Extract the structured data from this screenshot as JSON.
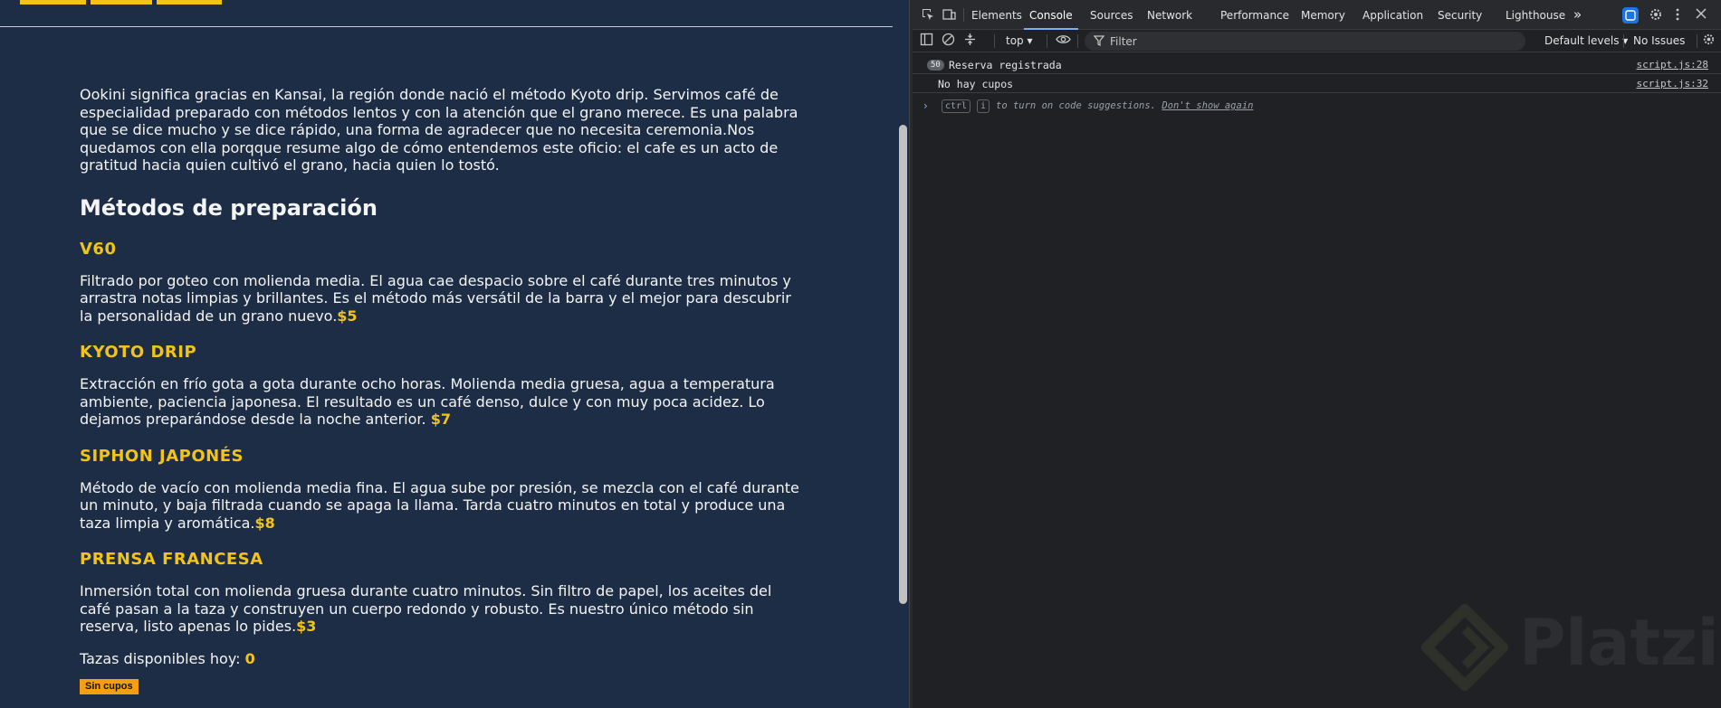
{
  "page": {
    "intro": "Ookini significa gracias en Kansai, la región donde nació el método Kyoto drip. Servimos café de especialidad preparado con métodos lentos y con la atención que el grano merece. Es una palabra que se dice mucho y se dice rápido, una forma de agradecer que no necesita ceremonia.Nos quedamos con ella porqque resume algo de cómo entendemos este oficio: el cafe es un acto de gratitud hacia quien cultivó el grano, hacia quien lo tostó.",
    "methods_heading": "Métodos de preparación",
    "methods": [
      {
        "title": "V60",
        "description": "Filtrado por goteo con molienda media. El agua cae despacio sobre el café durante tres minutos y arrastra notas limpias y brillantes. Es el método más versátil de la barra y el mejor para descubrir la personalidad de un grano nuevo.",
        "price": "$5"
      },
      {
        "title": "KYOTO DRIP",
        "description": "Extracción en frío gota a gota durante ocho horas. Molienda media gruesa, agua a temperatura ambiente, paciencia japonesa. El resultado es un café denso, dulce y con muy poca acidez. Lo dejamos preparándose desde la noche anterior. ",
        "price": "$7"
      },
      {
        "title": "SIPHON JAPONÉS",
        "description": "Método de vacío con molienda media fina. El agua sube por presión, se mezcla con el café durante un minuto, y baja filtrada cuando se apaga la llama. Tarda cuatro minutos en total y produce una taza limpia y aromática.",
        "price": "$8"
      },
      {
        "title": "PRENSA FRANCESA",
        "description": "Inmersión total con molienda gruesa durante cuatro minutos. Sin filtro de papel, los aceites del café pasan a la taza y construyen un cuerpo redondo y robusto. Es nuestro único método sin reserva, listo apenas lo pides.",
        "price": "$3"
      }
    ],
    "cups_label": "Tazas disponibles hoy: ",
    "cups_value": "0",
    "no_cups_button": "Sin cupos"
  },
  "devtools": {
    "tabs": [
      "Elements",
      "Console",
      "Sources",
      "Network",
      "Performance",
      "Memory",
      "Application",
      "Security",
      "Lighthouse"
    ],
    "active_tab": "Console",
    "overflow_icon": "»",
    "context": "top",
    "filter_placeholder": "Filter",
    "levels": "Default levels",
    "issues": "No Issues",
    "logs": [
      {
        "count": "50",
        "message": "Reserva registrada",
        "source": "script.js:28"
      },
      {
        "count": "",
        "message": "No hay cupos",
        "source": "script.js:32"
      }
    ],
    "hint": {
      "key1": "ctrl",
      "key2": "i",
      "text": " to turn on code suggestions. ",
      "link": "Don't show again"
    }
  },
  "watermark": {
    "brand": "Platzi"
  },
  "colors": {
    "page_bg": "#1d2d46",
    "accent": "#f2c318",
    "button_bg": "#f59e12",
    "devtools_bg": "#202124",
    "active_tab_underline": "#7cacf8"
  },
  "icons": [
    "inspect-icon",
    "device-toggle-icon",
    "sidebar-icon",
    "clear-icon",
    "filter-icon",
    "eye-icon",
    "settings-icon",
    "kebab-menu-icon",
    "ai-assist-icon"
  ]
}
